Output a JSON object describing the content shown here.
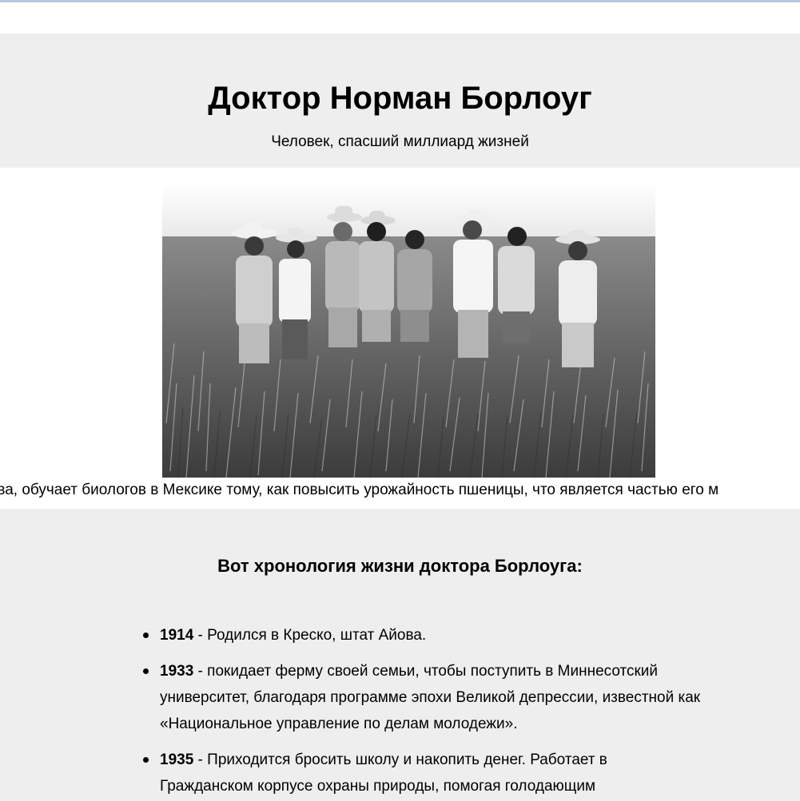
{
  "header": {
    "title": "Доктор Норман Борлоуг",
    "subtitle": "Человек, спасший миллиард жизней"
  },
  "photo": {
    "caption": "тий слева, обучает биологов в Мексике тому, как повысить урожайность пшеницы, что является частью его м"
  },
  "timeline": {
    "heading": "Вот хронология жизни доктора Борлоуга:",
    "items": [
      {
        "year": "1914",
        "text": " - Родился в Креско, штат Айова."
      },
      {
        "year": "1933",
        "text": " - покидает ферму своей семьи, чтобы поступить в Миннесотский университет, благодаря программе эпохи Великой депрессии, известной как «Национальное управление по делам молодежи»."
      },
      {
        "year": "1935",
        "text": " - Приходится бросить школу и накопить денег. Работает в Гражданском корпусе охраны природы, помогая голодающим"
      }
    ]
  }
}
